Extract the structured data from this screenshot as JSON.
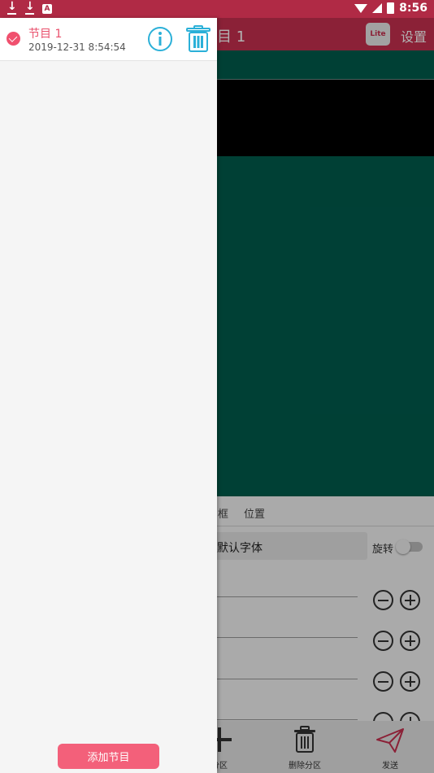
{
  "status_bar": {
    "time": "8:56",
    "icons": [
      "download-icon",
      "download-icon",
      "a-notification-icon",
      "wifi-icon",
      "signal-icon",
      "battery-icon"
    ]
  },
  "toolbar": {
    "title_visible": "目 1",
    "lite_badge": "Lite",
    "settings_label": "设置"
  },
  "panel": {
    "tab_border": "框",
    "tab_position": "位置",
    "font_value": "默认字体",
    "rotate_label": "旋转",
    "rotate_enabled": false
  },
  "bottom_bar": {
    "add_partition_label": "分区",
    "delete_partition_label": "删除分区",
    "send_label": "发送"
  },
  "drawer": {
    "programs": [
      {
        "name": "节目 1",
        "date": "2019-12-31 8:54:54",
        "checked": true
      }
    ],
    "add_program_label": "添加节目"
  },
  "colors": {
    "status_bar": "#b02a45",
    "toolbar": "#c8304f",
    "preview_bg": "#005c4d",
    "accent": "#f0506e",
    "info_icon": "#2bb0d8"
  }
}
